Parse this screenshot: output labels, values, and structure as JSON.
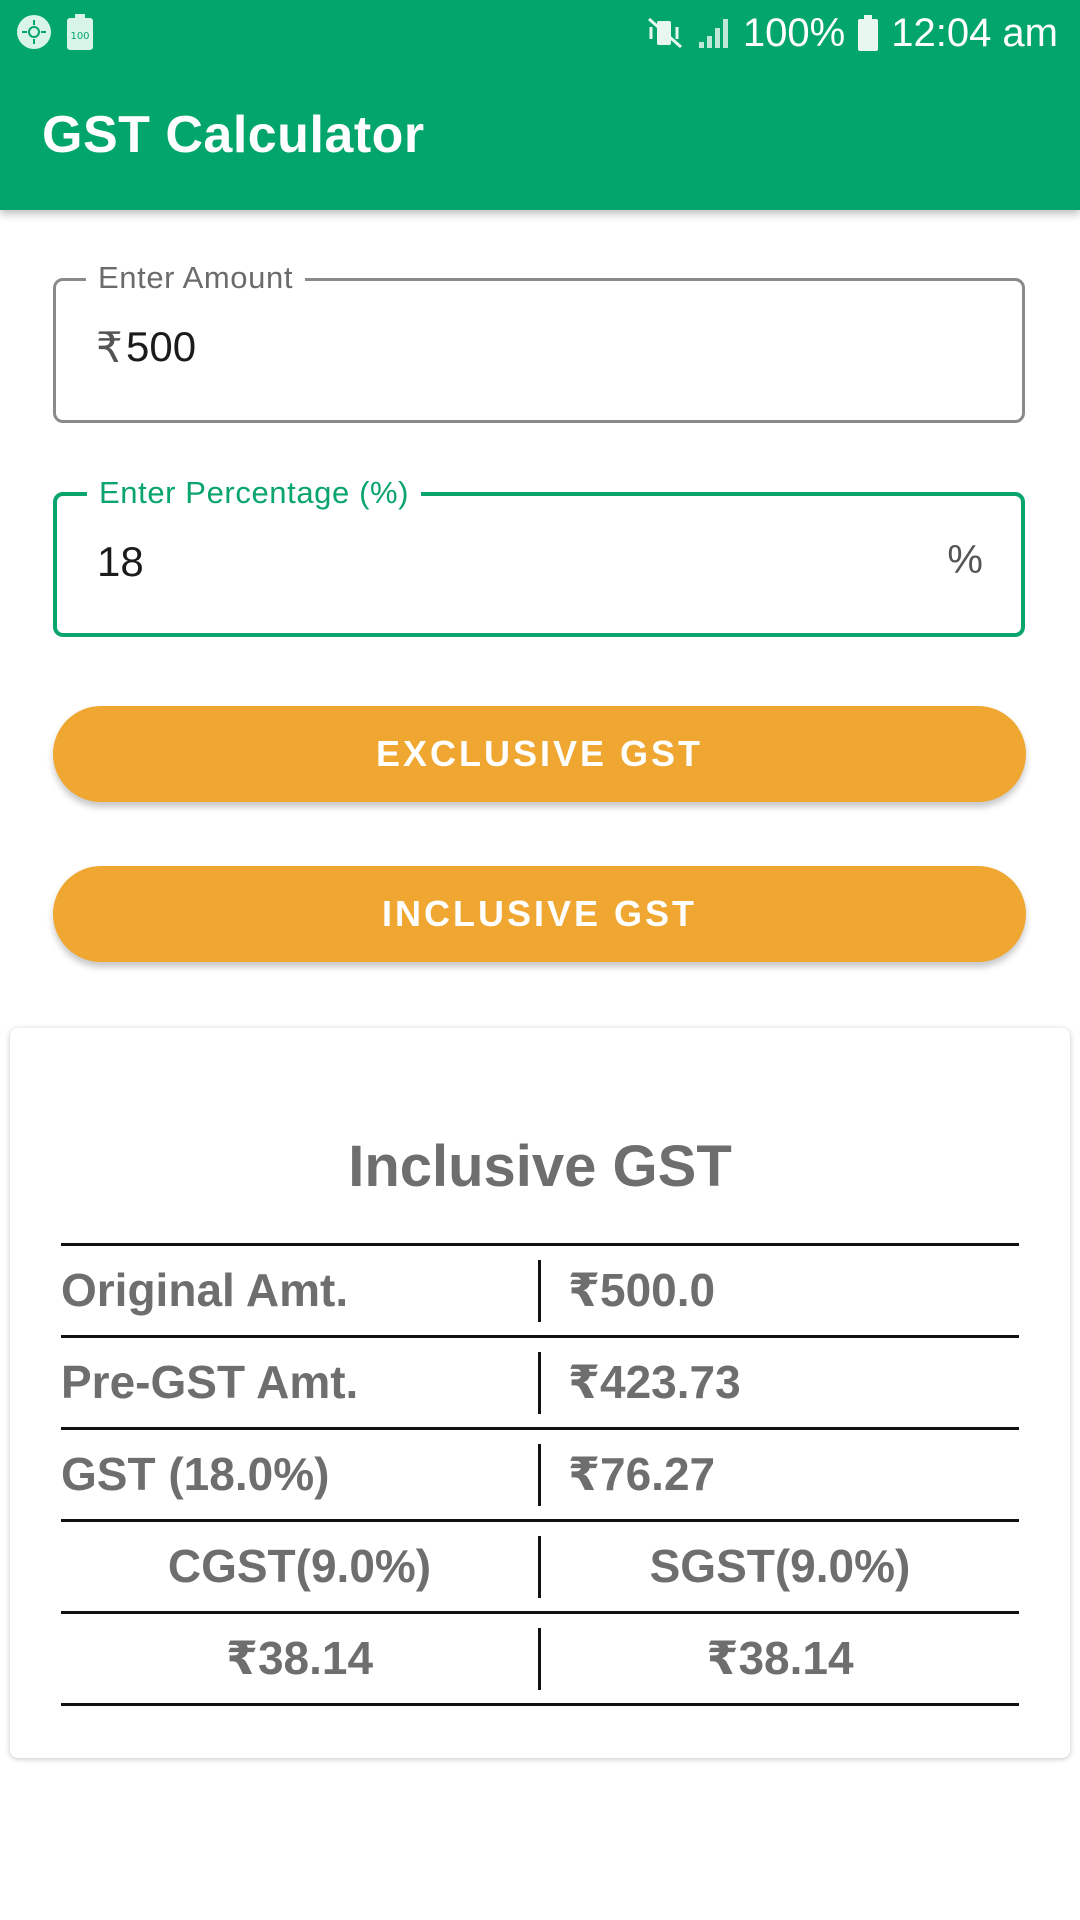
{
  "status_bar": {
    "battery_percent": "100%",
    "time": "12:04 am",
    "icons": [
      "notification-app-icon",
      "battery-100-notification-icon",
      "vibrate-mute-icon",
      "signal-icon",
      "battery-icon"
    ]
  },
  "app_bar": {
    "title": "GST Calculator"
  },
  "form": {
    "amount": {
      "label": "Enter Amount",
      "prefix": "₹",
      "value": "500"
    },
    "percentage": {
      "label": "Enter Percentage (%)",
      "value": "18",
      "suffix": "%"
    }
  },
  "buttons": {
    "exclusive": "EXCLUSIVE GST",
    "inclusive": "INCLUSIVE GST"
  },
  "result": {
    "title": "Inclusive GST",
    "rows": [
      {
        "label": "Original Amt.",
        "value": "₹500.0"
      },
      {
        "label": "Pre-GST Amt.",
        "value": "₹423.73"
      },
      {
        "label": "GST (18.0%)",
        "value": "₹76.27"
      }
    ],
    "split_header": {
      "cgst": "CGST(9.0%)",
      "sgst": "SGST(9.0%)"
    },
    "split_values": {
      "cgst": "₹38.14",
      "sgst": "₹38.14"
    }
  },
  "colors": {
    "primary": "#03a66a",
    "accent": "#f0a732",
    "text_gray": "#6e6e6e"
  }
}
